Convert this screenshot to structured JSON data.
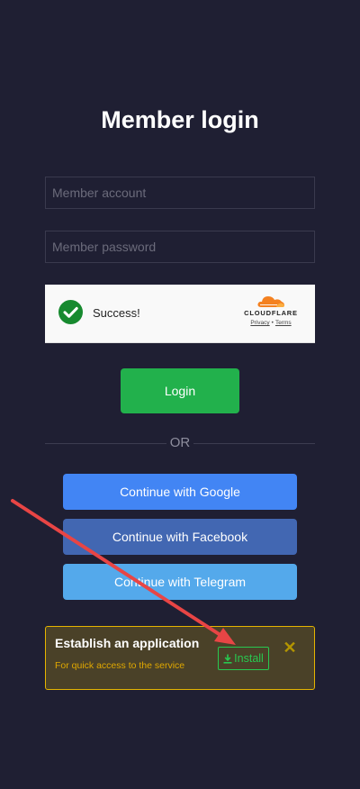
{
  "page": {
    "title": "Member login"
  },
  "form": {
    "account_placeholder": "Member account",
    "account_value": "",
    "password_placeholder": "Member password",
    "password_value": ""
  },
  "captcha": {
    "status_text": "Success!",
    "brand": "CLOUDFLARE",
    "privacy_link": "Privacy",
    "separator": "•",
    "terms_link": "Terms",
    "check_icon": "checkmark-circle-icon",
    "brand_icon": "cloudflare-cloud-icon",
    "colors": {
      "check": "#178a2f",
      "brand_orange": "#f48120"
    }
  },
  "login": {
    "button_label": "Login",
    "color": "#22b14c"
  },
  "divider": {
    "label": "OR"
  },
  "social": {
    "google_label": "Continue with Google",
    "facebook_label": "Continue with Facebook",
    "telegram_label": "Continue with Telegram",
    "colors": {
      "google": "#4285f4",
      "facebook": "#4267b2",
      "telegram": "#54a9eb"
    }
  },
  "install_banner": {
    "title": "Establish an application",
    "subtitle": "For quick access to the service",
    "install_label": "Install",
    "install_icon": "download-icon",
    "close_icon": "close-icon",
    "close_glyph": "✕",
    "colors": {
      "background": "#4a4128",
      "border": "#e5b400",
      "install": "#28c850"
    }
  },
  "annotation": {
    "arrow_color": "#e84545",
    "arrow_icon": "red-arrow-icon"
  }
}
